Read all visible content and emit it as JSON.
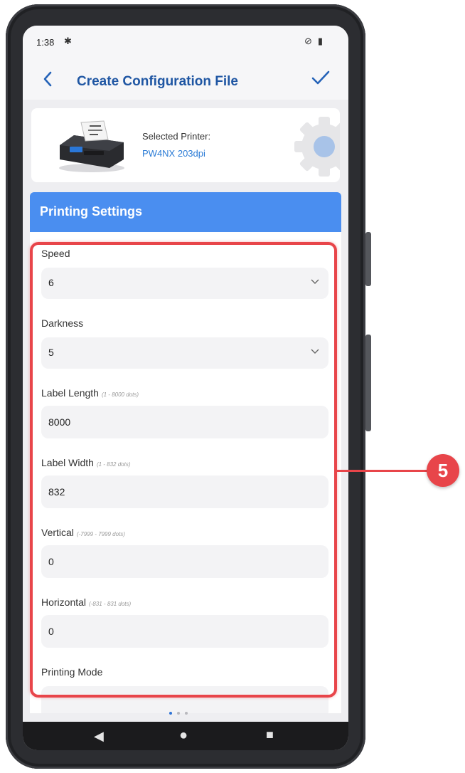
{
  "status_bar": {
    "time": "1:38",
    "bluetooth_icon": "bluetooth-icon",
    "icons": [
      "notifications-off-icon",
      "battery-icon"
    ]
  },
  "app_bar": {
    "back_icon": "chevron-left-icon",
    "title": "Create Configuration File",
    "confirm_icon": "checkmark-icon"
  },
  "printer_card": {
    "label": "Selected Printer:",
    "printer_name": "PW4NX 203dpi"
  },
  "section": {
    "title": "Printing Settings"
  },
  "fields": {
    "speed": {
      "label": "Speed",
      "value": "6"
    },
    "darkness": {
      "label": "Darkness",
      "value": "5"
    },
    "label_length": {
      "label": "Label Length",
      "hint": "(1 - 8000 dots)",
      "value": "8000"
    },
    "label_width": {
      "label": "Label Width",
      "hint": "(1 - 832 dots)",
      "value": "832"
    },
    "vertical": {
      "label": "Vertical",
      "hint": "(-7999 - 7999 dots)",
      "value": "0"
    },
    "horizontal": {
      "label": "Horizontal",
      "hint": "(-831 - 831 dots)",
      "value": "0"
    },
    "printing_mode": {
      "label": "Printing Mode"
    }
  },
  "callout": {
    "number": "5"
  },
  "pager": {
    "count": 3,
    "active_index": 0
  },
  "nav_bar": {
    "back_glyph": "◀",
    "home_glyph": "●",
    "recents_glyph": "■"
  },
  "colors": {
    "accent": "#4a8ef0",
    "title_blue": "#1f56a3",
    "link_blue": "#2a7bd6",
    "highlight_red": "#e8454a"
  }
}
